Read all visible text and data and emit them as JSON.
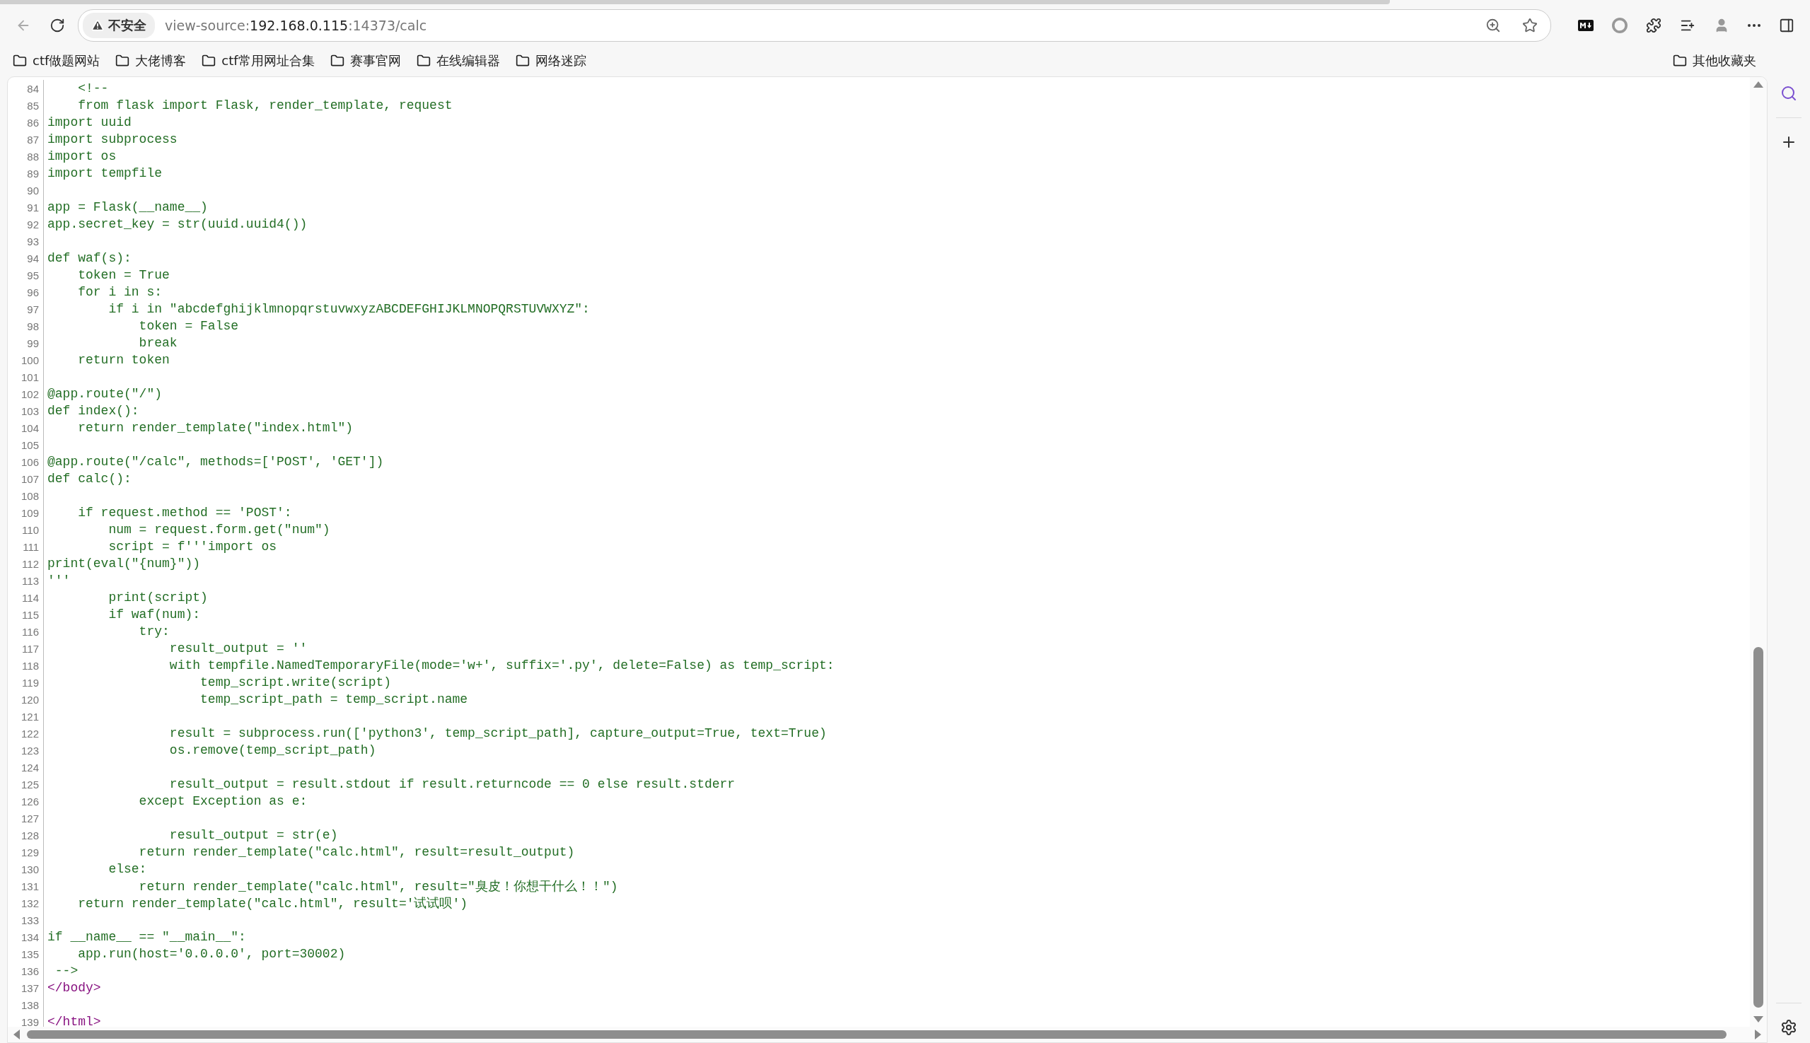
{
  "address_bar": {
    "security_label": "不安全",
    "scheme": "view-source:",
    "host": "192.168.0.115",
    "path": ":14373/calc"
  },
  "bookmarks": [
    {
      "label": "ctf做题网站"
    },
    {
      "label": "大佬博客"
    },
    {
      "label": "ctf常用网址合集"
    },
    {
      "label": "赛事官网"
    },
    {
      "label": "在线编辑器"
    },
    {
      "label": "网络迷踪"
    }
  ],
  "other_bookmarks": "其他收藏夹",
  "source_lines": [
    {
      "n": "84",
      "kind": "code",
      "text": "    <!--"
    },
    {
      "n": "85",
      "kind": "code",
      "text": "    from flask import Flask, render_template, request"
    },
    {
      "n": "86",
      "kind": "code",
      "text": "import uuid"
    },
    {
      "n": "87",
      "kind": "code",
      "text": "import subprocess"
    },
    {
      "n": "88",
      "kind": "code",
      "text": "import os"
    },
    {
      "n": "89",
      "kind": "code",
      "text": "import tempfile"
    },
    {
      "n": "90",
      "kind": "blank"
    },
    {
      "n": "91",
      "kind": "code",
      "text": "app = Flask(__name__)"
    },
    {
      "n": "92",
      "kind": "code",
      "text": "app.secret_key = str(uuid.uuid4())"
    },
    {
      "n": "93",
      "kind": "blank"
    },
    {
      "n": "94",
      "kind": "code",
      "text": "def waf(s):"
    },
    {
      "n": "95",
      "kind": "code",
      "text": "    token = True"
    },
    {
      "n": "96",
      "kind": "code",
      "text": "    for i in s:"
    },
    {
      "n": "97",
      "kind": "code",
      "text": "        if i in \"abcdefghijklmnopqrstuvwxyzABCDEFGHIJKLMNOPQRSTUVWXYZ\":"
    },
    {
      "n": "98",
      "kind": "code",
      "text": "            token = False"
    },
    {
      "n": "99",
      "kind": "code",
      "text": "            break"
    },
    {
      "n": "100",
      "kind": "code",
      "text": "    return token"
    },
    {
      "n": "101",
      "kind": "blank"
    },
    {
      "n": "102",
      "kind": "code",
      "text": "@app.route(\"/\")"
    },
    {
      "n": "103",
      "kind": "code",
      "text": "def index():"
    },
    {
      "n": "104",
      "kind": "code",
      "text": "    return render_template(\"index.html\")"
    },
    {
      "n": "105",
      "kind": "blank"
    },
    {
      "n": "106",
      "kind": "code",
      "text": "@app.route(\"/calc\", methods=['POST', 'GET'])"
    },
    {
      "n": "107",
      "kind": "code",
      "text": "def calc():"
    },
    {
      "n": "108",
      "kind": "blank"
    },
    {
      "n": "109",
      "kind": "code",
      "text": "    if request.method == 'POST':"
    },
    {
      "n": "110",
      "kind": "code",
      "text": "        num = request.form.get(\"num\")"
    },
    {
      "n": "111",
      "kind": "code",
      "text": "        script = f'''import os"
    },
    {
      "n": "112",
      "kind": "code",
      "text": "print(eval(\"{num}\"))"
    },
    {
      "n": "113",
      "kind": "code",
      "text": "'''"
    },
    {
      "n": "114",
      "kind": "code",
      "text": "        print(script)"
    },
    {
      "n": "115",
      "kind": "code",
      "text": "        if waf(num):"
    },
    {
      "n": "116",
      "kind": "code",
      "text": "            try:"
    },
    {
      "n": "117",
      "kind": "code",
      "text": "                result_output = ''"
    },
    {
      "n": "118",
      "kind": "code",
      "text": "                with tempfile.NamedTemporaryFile(mode='w+', suffix='.py', delete=False) as temp_script:"
    },
    {
      "n": "119",
      "kind": "code",
      "text": "                    temp_script.write(script)"
    },
    {
      "n": "120",
      "kind": "code",
      "text": "                    temp_script_path = temp_script.name"
    },
    {
      "n": "121",
      "kind": "blank"
    },
    {
      "n": "122",
      "kind": "code",
      "text": "                result = subprocess.run(['python3', temp_script_path], capture_output=True, text=True)"
    },
    {
      "n": "123",
      "kind": "code",
      "text": "                os.remove(temp_script_path)"
    },
    {
      "n": "124",
      "kind": "blank"
    },
    {
      "n": "125",
      "kind": "code",
      "text": "                result_output = result.stdout if result.returncode == 0 else result.stderr"
    },
    {
      "n": "126",
      "kind": "code",
      "text": "            except Exception as e:"
    },
    {
      "n": "127",
      "kind": "blank"
    },
    {
      "n": "128",
      "kind": "code",
      "text": "                result_output = str(e)"
    },
    {
      "n": "129",
      "kind": "code",
      "text": "            return render_template(\"calc.html\", result=result_output)"
    },
    {
      "n": "130",
      "kind": "code",
      "text": "        else:"
    },
    {
      "n": "131",
      "kind": "code",
      "text": "            return render_template(\"calc.html\", result=\"臭皮！你想干什么！！\")"
    },
    {
      "n": "132",
      "kind": "code",
      "text": "    return render_template(\"calc.html\", result='试试呗')"
    },
    {
      "n": "133",
      "kind": "blank"
    },
    {
      "n": "134",
      "kind": "code",
      "text": "if __name__ == \"__main__\":"
    },
    {
      "n": "135",
      "kind": "code",
      "text": "    app.run(host='0.0.0.0', port=30002)"
    },
    {
      "n": "136",
      "kind": "code",
      "text": " -->"
    },
    {
      "n": "137",
      "kind": "tag",
      "text": "</body>"
    },
    {
      "n": "138",
      "kind": "blank"
    },
    {
      "n": "139",
      "kind": "tag",
      "text": "</html>"
    }
  ]
}
